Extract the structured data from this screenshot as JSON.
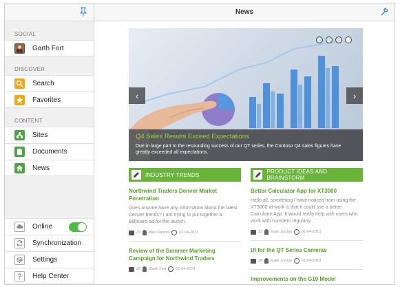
{
  "sidebar": {
    "sections": {
      "social": "SOCIAL",
      "discover": "DISCOVER",
      "content": "CONTENT"
    },
    "social_items": [
      {
        "label": "Garth Fort"
      }
    ],
    "discover_items": [
      {
        "label": "Search"
      },
      {
        "label": "Favorites"
      }
    ],
    "content_items": [
      {
        "label": "Sites"
      },
      {
        "label": "Documents"
      },
      {
        "label": "News"
      }
    ],
    "bottom_items": [
      {
        "label": "Online",
        "toggle_on": true
      },
      {
        "label": "Synchronization"
      },
      {
        "label": "Settings"
      },
      {
        "label": "Help Center"
      }
    ]
  },
  "header": {
    "title": "News"
  },
  "hero": {
    "title": "Q4 Sales Results Exceed Expectations",
    "text": "Due in large part to the resounding success of our QT series, the Contoso Q4 sales figures have greatly exceeded all expectations.",
    "active_slide": 4,
    "slide_count": 4
  },
  "columns": [
    {
      "heading": "INDUSTRY TRENDS",
      "articles": [
        {
          "title": "Northwind Traders Denver Market Penetration",
          "body": "Does anyone have any information about the latest Denver trends? I am trying to put together a Billboard ad for the launch.",
          "count": "29",
          "author": "Alex Darrow",
          "date": "01-04-2013"
        },
        {
          "title": "Review of the Summer Marketing Campaign for Northwind Traders",
          "body": "",
          "count": "26",
          "author": "Garth Fort",
          "date": "01-04-2013"
        }
      ]
    },
    {
      "heading": "PRODUCT IDEAS AND BRAINSTORM",
      "articles": [
        {
          "title": "Better Calculator App for XT3000",
          "body": "Hello all, something I have noticed from using the XT3000 at work is that it could use a better Calculator App.  It would really help with users who work with numbers regularly.",
          "count": "33",
          "author": "Katie Jordan",
          "date": "01-04-2013"
        },
        {
          "title": "UI for the QT Series Cameras",
          "body": "",
          "count": "28",
          "author": "Katie Jordan",
          "date": "01-04-2013"
        },
        {
          "title": "Improvements on the G10 Model",
          "body": "",
          "count": "",
          "author": "",
          "date": ""
        }
      ]
    }
  ],
  "colors": {
    "accent_green": "#6ab43c",
    "title_green": "#57a02a",
    "caption_green": "#9ed23a",
    "toggle_green": "#4cbc44"
  }
}
